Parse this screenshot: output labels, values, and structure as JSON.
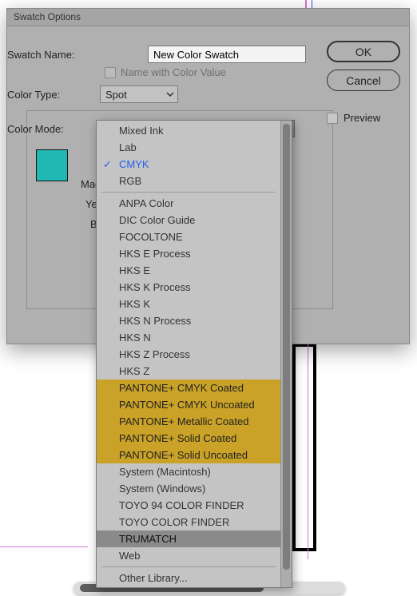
{
  "dialog": {
    "title": "Swatch Options",
    "swatch_name_label": "Swatch Name:",
    "swatch_name_value": "New Color Swatch",
    "name_with_color_label": "Name with Color Value",
    "name_with_color_checked": false,
    "color_type_label": "Color Type:",
    "color_type_value": "Spot",
    "color_mode_label": "Color Mode:",
    "color_mode_value": "CMYK",
    "slider_labels": {
      "mag": "Mag",
      "ye": "Ye",
      "b": "B"
    },
    "swatch_color": "#1fb8b3",
    "ok_label": "OK",
    "cancel_label": "Cancel",
    "preview_label": "Preview",
    "preview_checked": false
  },
  "dropdown": {
    "selected": "CMYK",
    "hovered": "TRUMATCH",
    "groups": [
      {
        "items": [
          "Mixed Ink",
          "Lab",
          "CMYK",
          "RGB"
        ]
      },
      {
        "items": [
          "ANPA Color",
          "DIC Color Guide",
          "FOCOLTONE",
          "HKS E Process",
          "HKS E",
          "HKS K Process",
          "HKS K",
          "HKS N Process",
          "HKS N",
          "HKS Z Process",
          "HKS Z",
          "PANTONE+ CMYK Coated",
          "PANTONE+ CMYK Uncoated",
          "PANTONE+ Metallic Coated",
          "PANTONE+ Solid Coated",
          "PANTONE+ Solid Uncoated",
          "System (Macintosh)",
          "System (Windows)",
          "TOYO 94 COLOR FINDER",
          "TOYO COLOR FINDER",
          "TRUMATCH",
          "Web"
        ]
      },
      {
        "items": [
          "Other Library..."
        ]
      }
    ],
    "pantone_highlight": [
      "PANTONE+ CMYK Coated",
      "PANTONE+ CMYK Uncoated",
      "PANTONE+ Metallic Coated",
      "PANTONE+ Solid Coated",
      "PANTONE+ Solid Uncoated"
    ]
  }
}
